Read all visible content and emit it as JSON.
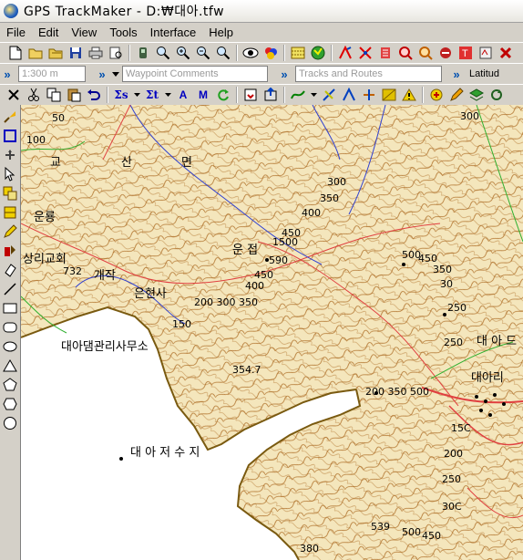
{
  "window": {
    "title": "GPS TrackMaker - D:₩대아.tfw"
  },
  "menu": [
    {
      "label": "File"
    },
    {
      "label": "Edit"
    },
    {
      "label": "View"
    },
    {
      "label": "Tools"
    },
    {
      "label": "Interface"
    },
    {
      "label": "Help"
    }
  ],
  "toolbar2": {
    "scale_value": "1:300 m",
    "waypoint_placeholder": "Waypoint Comments",
    "tracks_placeholder": "Tracks and Routes",
    "latitude_label": "Latitud"
  },
  "map": {
    "labels": [
      {
        "id": "label-50",
        "text": "50"
      },
      {
        "id": "label-100",
        "text": "100"
      },
      {
        "id": "label-gyo",
        "text": "교"
      },
      {
        "id": "label-san",
        "text": "산"
      },
      {
        "id": "label-myeon",
        "text": "면"
      },
      {
        "id": "label-300-top",
        "text": "300"
      },
      {
        "id": "label-300",
        "text": "300"
      },
      {
        "id": "label-350",
        "text": "350"
      },
      {
        "id": "label-400",
        "text": "400"
      },
      {
        "id": "label-eunryong",
        "text": "운룡"
      },
      {
        "id": "label-450-1500",
        "text": "450"
      },
      {
        "id": "label-1500",
        "text": "1500"
      },
      {
        "id": "label-unjeop",
        "text": "운 접"
      },
      {
        "id": "label-590",
        "text": "590"
      },
      {
        "id": "label-450-b",
        "text": "450"
      },
      {
        "id": "label-400-b",
        "text": "400"
      },
      {
        "id": "label-church",
        "text": "상리교회"
      },
      {
        "id": "label-732",
        "text": "732"
      },
      {
        "id": "label-gaejak",
        "text": "개작"
      },
      {
        "id": "label-eunhyeonsa",
        "text": "은현사"
      },
      {
        "id": "label-200-300-350",
        "text": "200 300 350"
      },
      {
        "id": "label-150",
        "text": "150"
      },
      {
        "id": "label-dam-office",
        "text": "대아댐관리사무소"
      },
      {
        "id": "label-354-7",
        "text": "354.7"
      },
      {
        "id": "label-200-350-500",
        "text": "200 350 500"
      },
      {
        "id": "label-reservoir",
        "text": "대 아 저 수 지"
      },
      {
        "id": "label-500-e",
        "text": "500"
      },
      {
        "id": "label-450-e",
        "text": "450"
      },
      {
        "id": "label-350-e",
        "text": "350"
      },
      {
        "id": "label-30-e",
        "text": "30"
      },
      {
        "id": "label-250-e",
        "text": "250"
      },
      {
        "id": "label-250-e2",
        "text": "250"
      },
      {
        "id": "label-dae-a",
        "text": "대 아 드"
      },
      {
        "id": "label-daea-ri",
        "text": "대아리"
      },
      {
        "id": "label-150-e",
        "text": "15C"
      },
      {
        "id": "label-200-e",
        "text": "200"
      },
      {
        "id": "label-250-e3",
        "text": "250"
      },
      {
        "id": "label-300-e",
        "text": "30C"
      },
      {
        "id": "label-539",
        "text": "539"
      },
      {
        "id": "label-500-s",
        "text": "500"
      },
      {
        "id": "label-450-s",
        "text": "450"
      },
      {
        "id": "label-380",
        "text": "380"
      }
    ]
  }
}
